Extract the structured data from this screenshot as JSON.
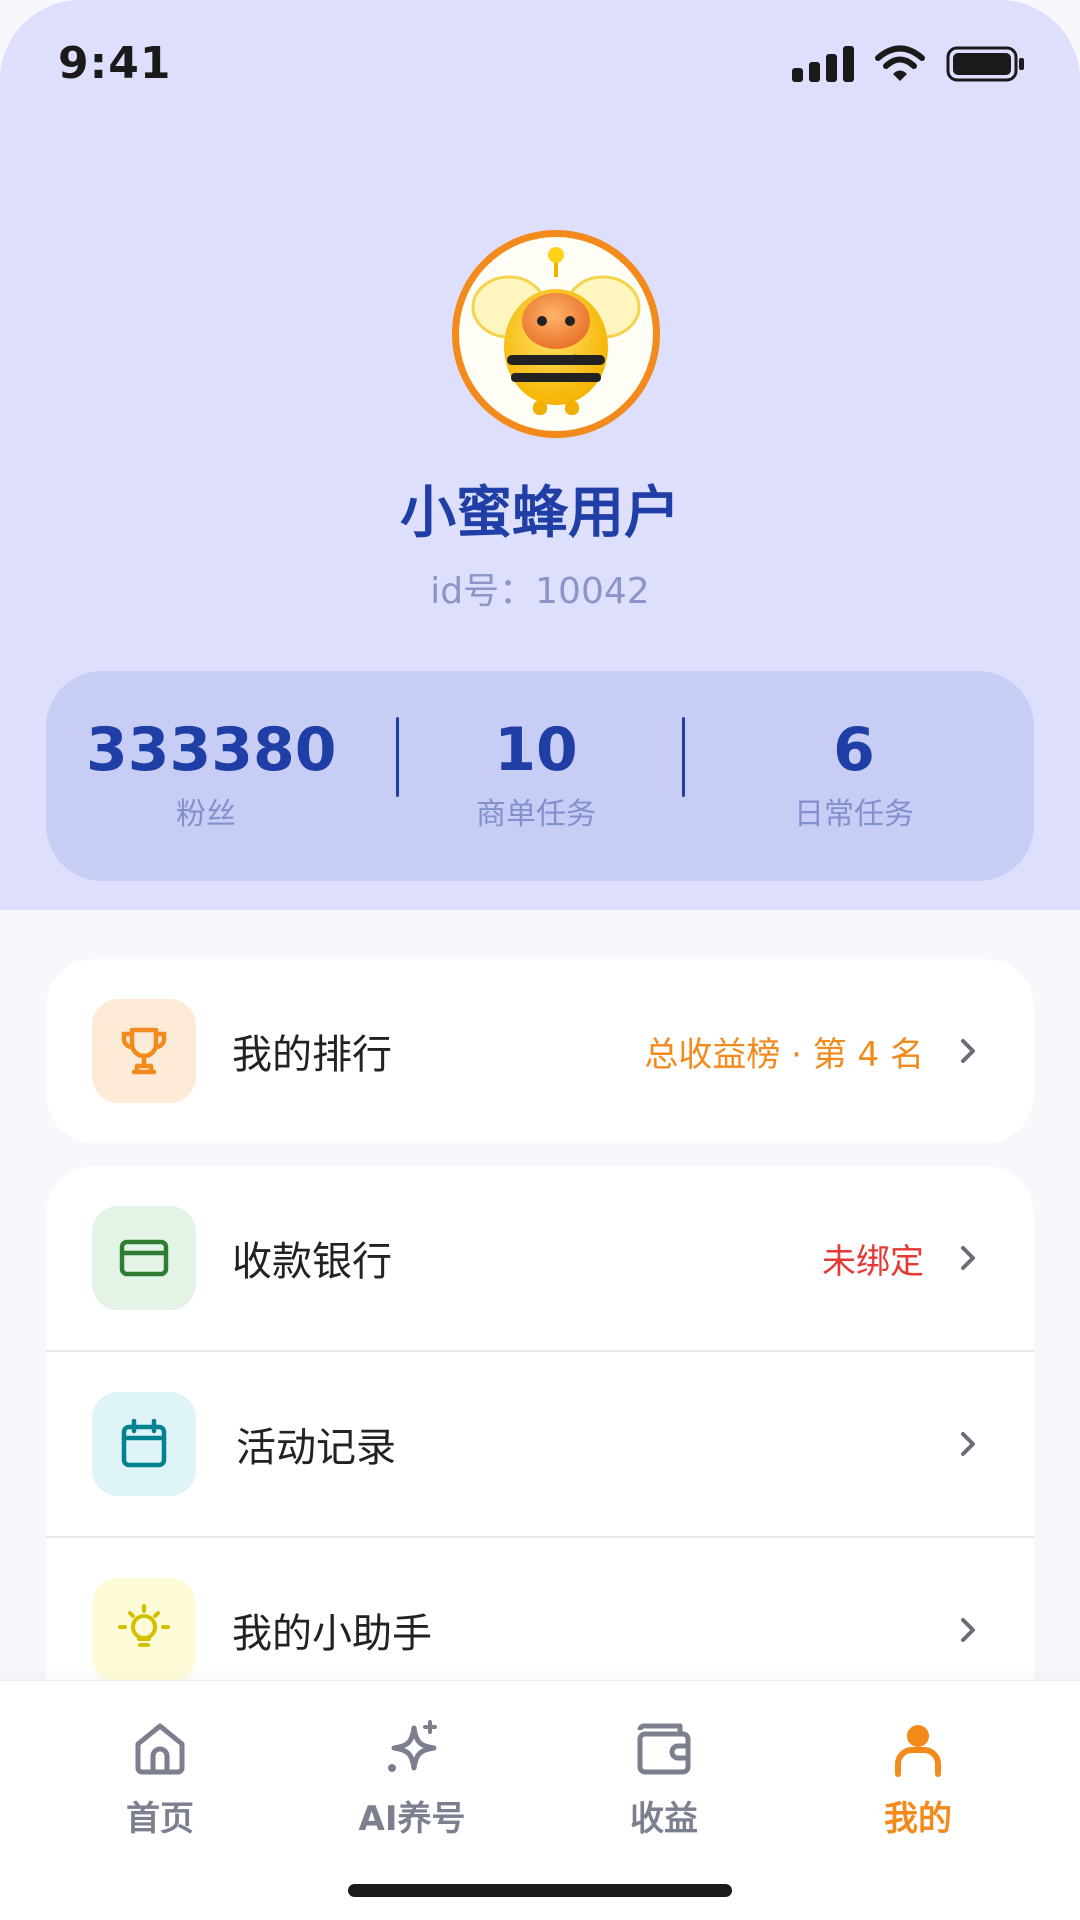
{
  "status_bar": {
    "time": "9:41"
  },
  "profile": {
    "username": "小蜜蜂用户",
    "id_text": "id号：10042"
  },
  "stats": [
    {
      "value": "333380",
      "label": "粉丝"
    },
    {
      "value": "10",
      "label": "商单任务"
    },
    {
      "value": "6",
      "label": "日常任务"
    }
  ],
  "menu": {
    "ranking": {
      "label": "我的排行",
      "value": "总收益榜 · 第 4 名",
      "icon": "trophy-icon"
    },
    "bank": {
      "label": "收款银行",
      "value": "未绑定",
      "icon": "credit-card-icon"
    },
    "activity": {
      "label": "活动记录",
      "icon": "calendar-icon"
    },
    "assistant": {
      "label": "我的小助手",
      "icon": "lightbulb-icon"
    }
  },
  "tabbar": {
    "items": [
      {
        "label": "首页",
        "icon": "home-icon"
      },
      {
        "label": "AI养号",
        "icon": "sparkle-icon"
      },
      {
        "label": "收益",
        "icon": "wallet-icon"
      },
      {
        "label": "我的",
        "icon": "person-icon",
        "active": true
      }
    ]
  },
  "colors": {
    "header_bg": "#dedffd",
    "accent_blue": "#1f3ea6",
    "accent_orange": "#f28a1c",
    "warning_red": "#e53935"
  }
}
